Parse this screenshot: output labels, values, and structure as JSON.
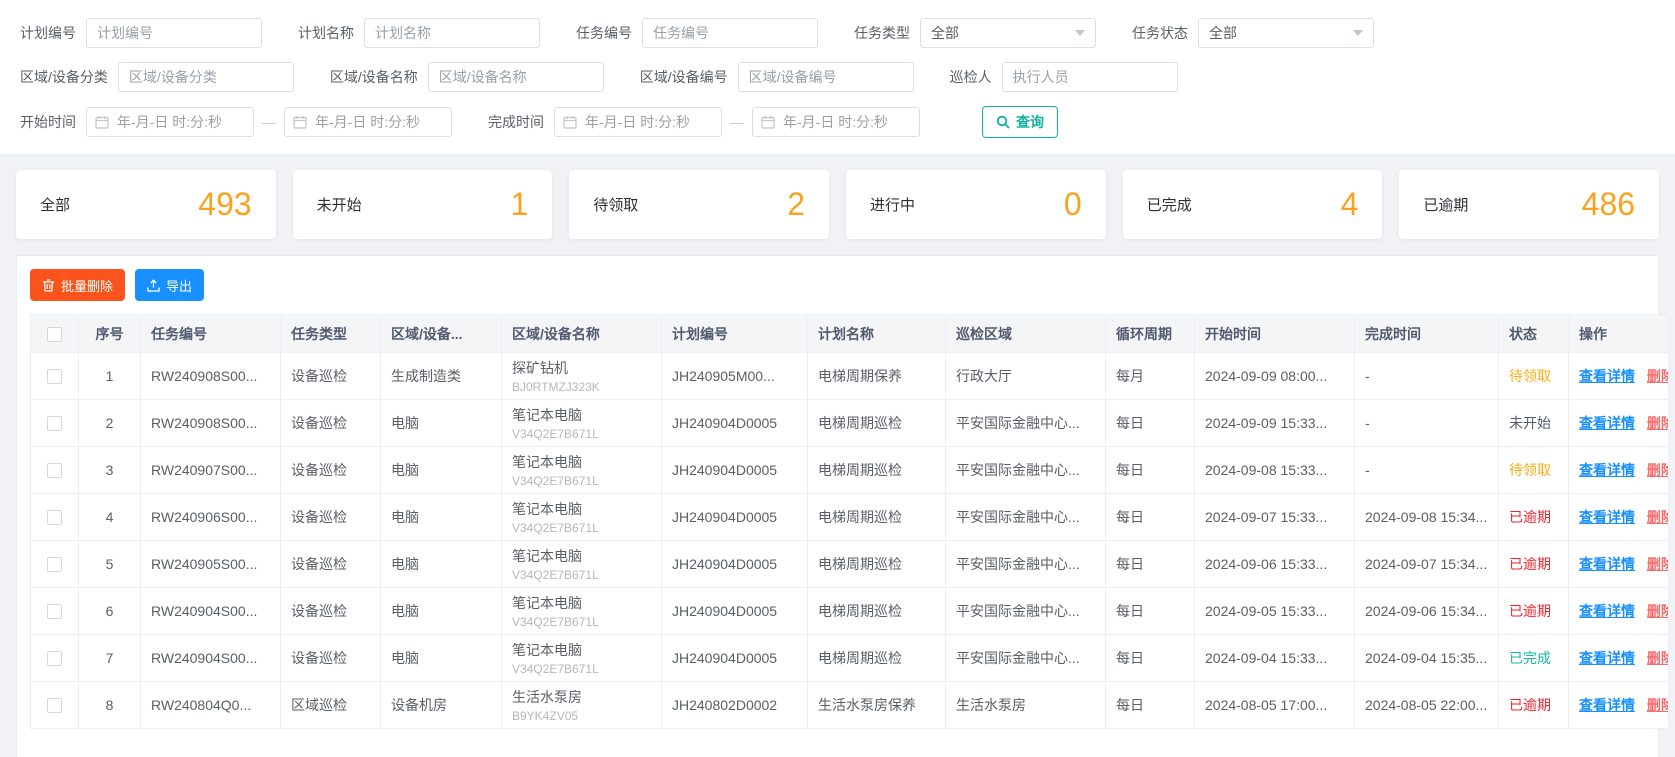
{
  "filters": {
    "row1": [
      {
        "label": "计划编号",
        "placeholder": "计划编号"
      },
      {
        "label": "计划名称",
        "placeholder": "计划名称"
      },
      {
        "label": "任务编号",
        "placeholder": "任务编号"
      },
      {
        "label": "任务类型",
        "value": "全部"
      },
      {
        "label": "任务状态",
        "value": "全部"
      }
    ],
    "row2": [
      {
        "label": "区域/设备分类",
        "placeholder": "区域/设备分类"
      },
      {
        "label": "区域/设备名称",
        "placeholder": "区域/设备名称"
      },
      {
        "label": "区域/设备编号",
        "placeholder": "区域/设备编号"
      },
      {
        "label": "巡检人",
        "placeholder": "执行人员"
      }
    ],
    "row3": {
      "start_label": "开始时间",
      "finish_label": "完成时间",
      "date_placeholder": "年-月-日 时:分:秒",
      "range_separator": "—",
      "search_button": "查询"
    }
  },
  "stats": [
    {
      "label": "全部",
      "value": "493"
    },
    {
      "label": "未开始",
      "value": "1"
    },
    {
      "label": "待领取",
      "value": "2"
    },
    {
      "label": "进行中",
      "value": "0"
    },
    {
      "label": "已完成",
      "value": "4"
    },
    {
      "label": "已逾期",
      "value": "486"
    }
  ],
  "toolbar": {
    "batch_delete": "批量删除",
    "export": "导出"
  },
  "table": {
    "columns": [
      "序号",
      "任务编号",
      "任务类型",
      "区域/设备...",
      "区域/设备名称",
      "计划编号",
      "计划名称",
      "巡检区域",
      "循环周期",
      "开始时间",
      "完成时间",
      "状态",
      "操作"
    ],
    "actions": {
      "view": "查看详情",
      "delete": "删除"
    },
    "rows": [
      {
        "index": "1",
        "task_no": "RW240908S00...",
        "task_type": "设备巡检",
        "device_category": "生成制造类",
        "device_name": "探矿钻机",
        "device_code": "BJ0RTMZJ323K",
        "plan_no": "JH240905M00...",
        "plan_name": "电梯周期保养",
        "area": "行政大厅",
        "cycle": "每月",
        "start_time": "2024-09-09 08:00...",
        "finish_time": "-",
        "status": "待领取",
        "status_type": "pending"
      },
      {
        "index": "2",
        "task_no": "RW240908S00...",
        "task_type": "设备巡检",
        "device_category": "电脑",
        "device_name": "笔记本电脑",
        "device_code": "V34Q2E7B671L",
        "plan_no": "JH240904D0005",
        "plan_name": "电梯周期巡检",
        "area": "平安国际金融中心...",
        "cycle": "每日",
        "start_time": "2024-09-09 15:33...",
        "finish_time": "-",
        "status": "未开始",
        "status_type": "notstarted"
      },
      {
        "index": "3",
        "task_no": "RW240907S00...",
        "task_type": "设备巡检",
        "device_category": "电脑",
        "device_name": "笔记本电脑",
        "device_code": "V34Q2E7B671L",
        "plan_no": "JH240904D0005",
        "plan_name": "电梯周期巡检",
        "area": "平安国际金融中心...",
        "cycle": "每日",
        "start_time": "2024-09-08 15:33...",
        "finish_time": "-",
        "status": "待领取",
        "status_type": "pending"
      },
      {
        "index": "4",
        "task_no": "RW240906S00...",
        "task_type": "设备巡检",
        "device_category": "电脑",
        "device_name": "笔记本电脑",
        "device_code": "V34Q2E7B671L",
        "plan_no": "JH240904D0005",
        "plan_name": "电梯周期巡检",
        "area": "平安国际金融中心...",
        "cycle": "每日",
        "start_time": "2024-09-07 15:33...",
        "finish_time": "2024-09-08 15:34...",
        "status": "已逾期",
        "status_type": "overdue"
      },
      {
        "index": "5",
        "task_no": "RW240905S00...",
        "task_type": "设备巡检",
        "device_category": "电脑",
        "device_name": "笔记本电脑",
        "device_code": "V34Q2E7B671L",
        "plan_no": "JH240904D0005",
        "plan_name": "电梯周期巡检",
        "area": "平安国际金融中心...",
        "cycle": "每日",
        "start_time": "2024-09-06 15:33...",
        "finish_time": "2024-09-07 15:34...",
        "status": "已逾期",
        "status_type": "overdue"
      },
      {
        "index": "6",
        "task_no": "RW240904S00...",
        "task_type": "设备巡检",
        "device_category": "电脑",
        "device_name": "笔记本电脑",
        "device_code": "V34Q2E7B671L",
        "plan_no": "JH240904D0005",
        "plan_name": "电梯周期巡检",
        "area": "平安国际金融中心...",
        "cycle": "每日",
        "start_time": "2024-09-05 15:33...",
        "finish_time": "2024-09-06 15:34...",
        "status": "已逾期",
        "status_type": "overdue"
      },
      {
        "index": "7",
        "task_no": "RW240904S00...",
        "task_type": "设备巡检",
        "device_category": "电脑",
        "device_name": "笔记本电脑",
        "device_code": "V34Q2E7B671L",
        "plan_no": "JH240904D0005",
        "plan_name": "电梯周期巡检",
        "area": "平安国际金融中心...",
        "cycle": "每日",
        "start_time": "2024-09-04 15:33...",
        "finish_time": "2024-09-04 15:35...",
        "status": "已完成",
        "status_type": "done"
      },
      {
        "index": "8",
        "task_no": "RW240804Q0...",
        "task_type": "区域巡检",
        "device_category": "设备机房",
        "device_name": "生活水泵房",
        "device_code": "B9YK4ZV05",
        "plan_no": "JH240802D0002",
        "plan_name": "生活水泵房保养",
        "area": "生活水泵房",
        "cycle": "每日",
        "start_time": "2024-08-05 17:00...",
        "finish_time": "2024-08-05 22:00...",
        "status": "已逾期",
        "status_type": "overdue"
      }
    ]
  },
  "colors": {
    "stat_value": "#faa21e",
    "status": {
      "pending": "#faad14",
      "notstarted": "#515a6e",
      "overdue": "#f5222d",
      "done": "#13b8a6"
    },
    "link_view": "#1890ff",
    "link_delete": "#f56c6c",
    "button_batch_delete": "#fa541c",
    "button_export": "#1890ff",
    "search_button": "#12b1a1"
  }
}
